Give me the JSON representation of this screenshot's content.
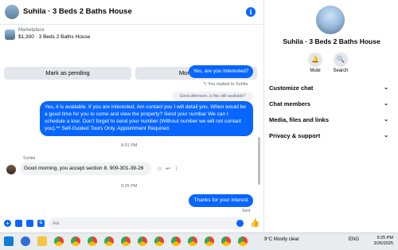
{
  "header": {
    "title": "Suhila · 3 Beds 2 Baths House"
  },
  "listing": {
    "category": "Marketplace",
    "price_line": "$1,300 · 3 Beds 2 Baths House"
  },
  "actions": {
    "mark_pending": "Mark as pending",
    "more_options": "More options"
  },
  "messages": {
    "out1": "Yes, are you interested?",
    "replied_note": "↰ You replied to Suhila",
    "quoted": "Good afternoon, is this still available?",
    "out2": "Yes, it is available. If you are interested.  Am contact you I will detail you.  When would be a good time for you to come and view the property? Send your numbar We can I schedule a tour.  Don't forget to send your number (Without number we will not contact you).** Self-Guided Tours Only. Appointment Required.",
    "time1": "8:01 PM",
    "sender": "Suhila",
    "in1": "Good morning, you accept section 8. 909-301-39-26",
    "time2": "9:25 PM",
    "out3": "Thanks for your interest",
    "status": "Sent"
  },
  "composer": {
    "placeholder": "Aa"
  },
  "right": {
    "title": "Suhila · 3 Beds 2 Baths House",
    "mute": "Mute",
    "search": "Search",
    "sections": [
      "Customize chat",
      "Chat members",
      "Media, files and links",
      "Privacy & support"
    ]
  },
  "taskbar": {
    "weather": "9°C  Mostly clear",
    "lang": "ENG",
    "time": "9:25 PM",
    "date": "3/26/2025"
  },
  "colors": {
    "accent": "#0866ff",
    "bubble_in": "#f0f2f5"
  }
}
